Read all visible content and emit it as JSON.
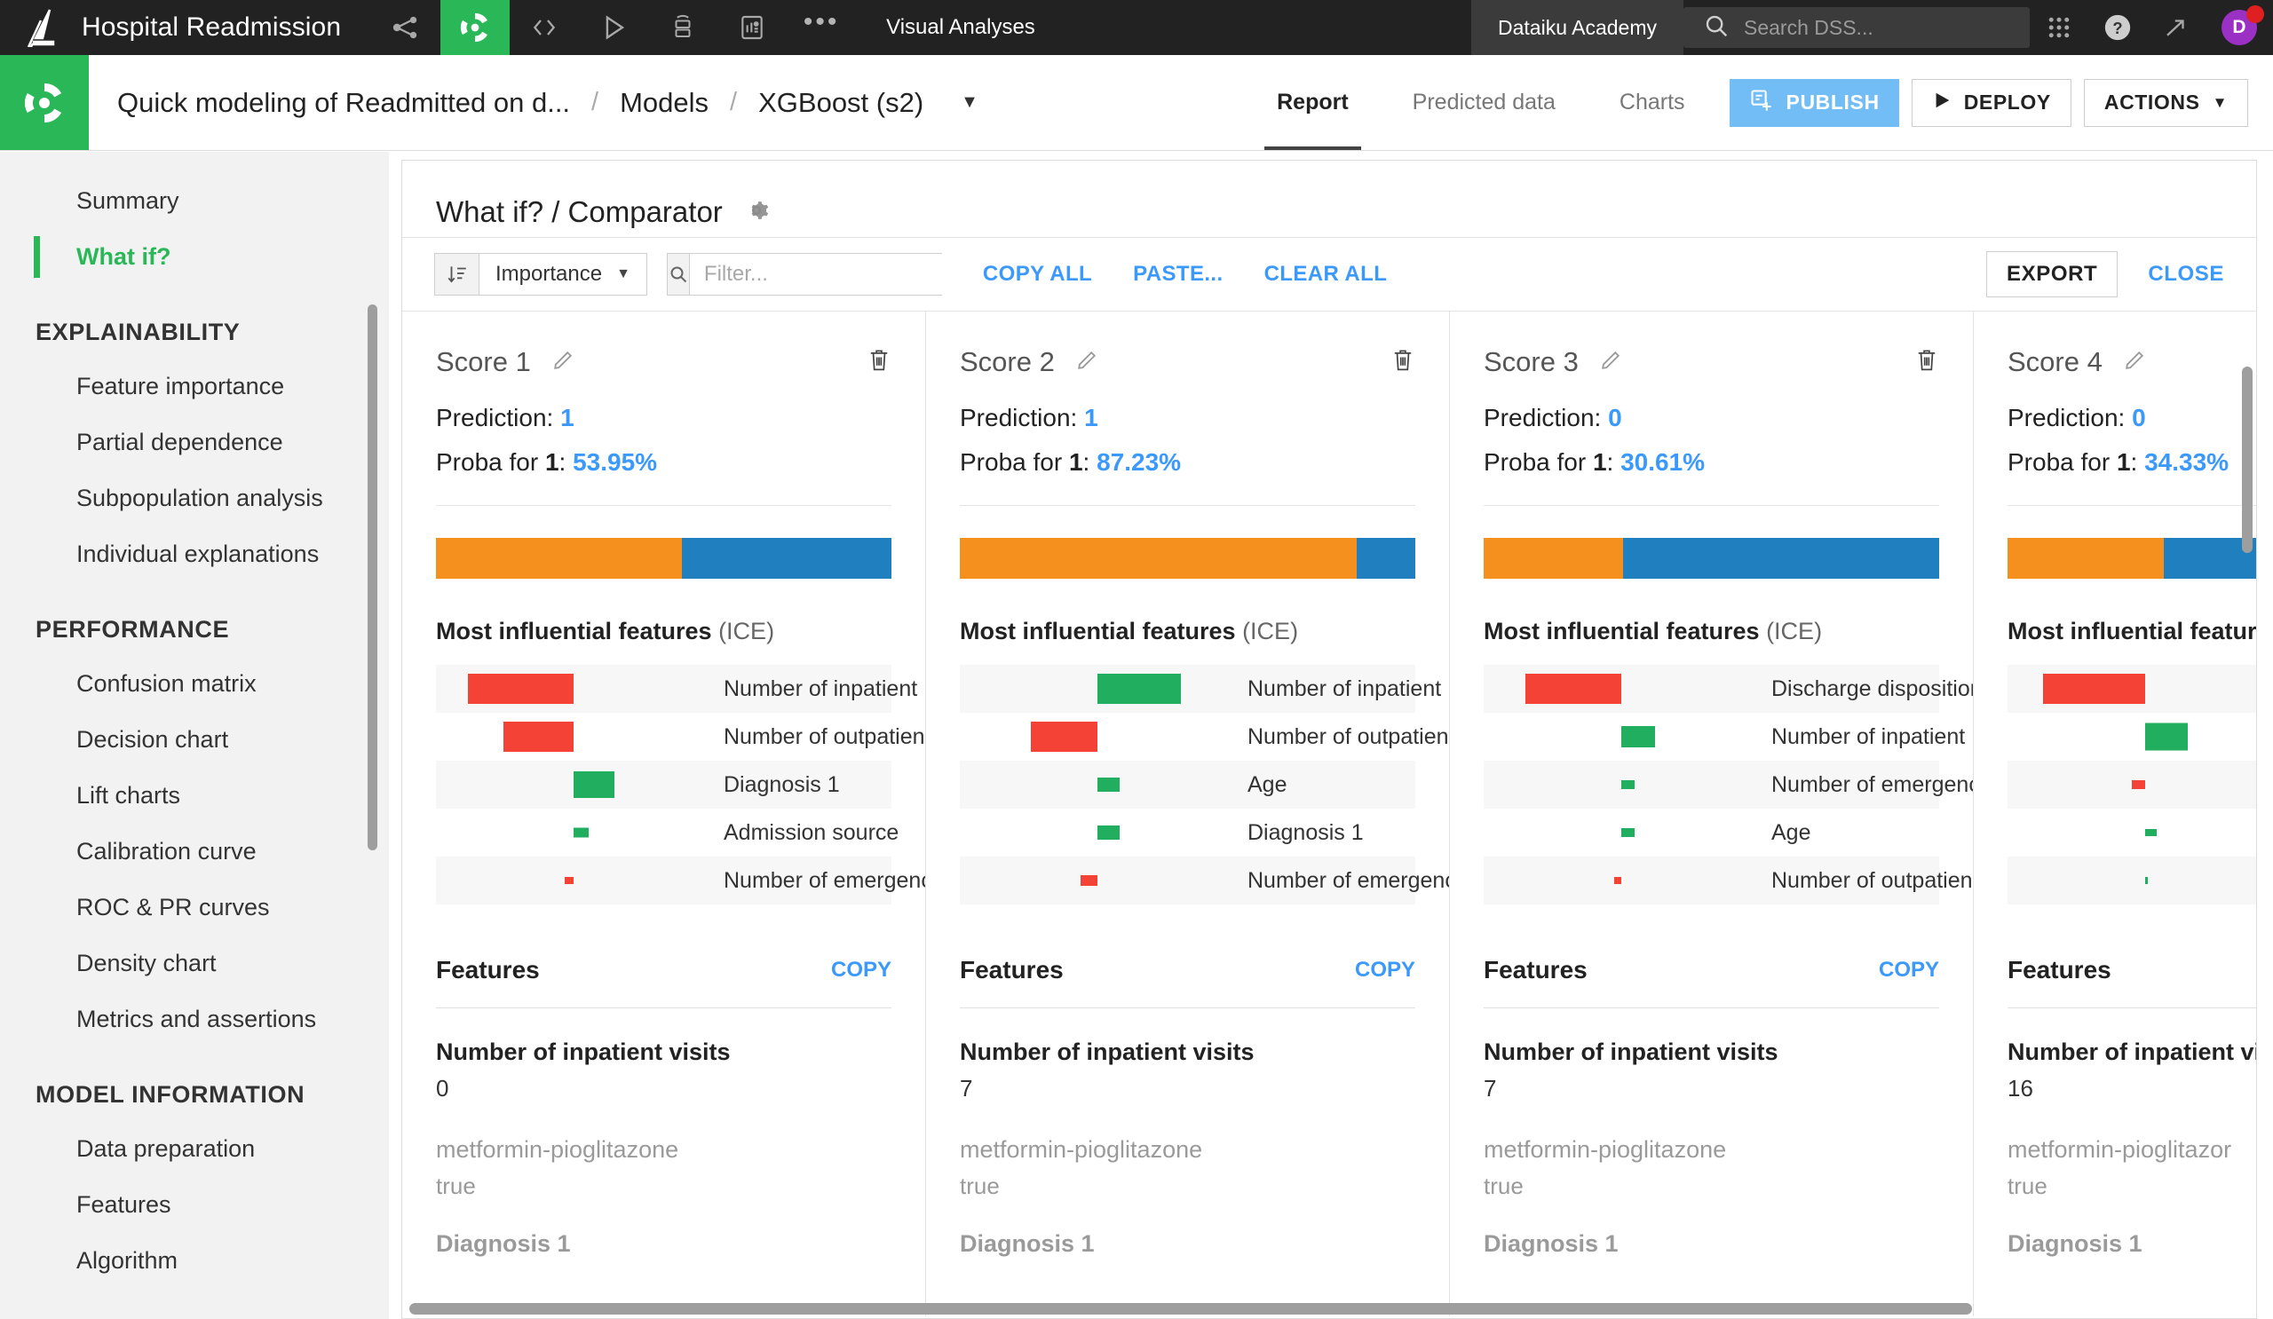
{
  "topbar": {
    "project_name": "Hospital Readmission",
    "icons": [
      "flow-icon",
      "dataiku-logo-icon",
      "code-icon",
      "play-icon",
      "jobs-icon",
      "dashboard-icon",
      "more-icon"
    ],
    "section_label": "Visual Analyses",
    "academy_label": "Dataiku Academy",
    "search_placeholder": "Search DSS...",
    "right_icons": [
      "apps-grid-icon",
      "help-icon",
      "trends-icon"
    ],
    "avatar_initial": "D"
  },
  "header": {
    "breadcrumb": [
      {
        "label": "Quick modeling of Readmitted on d..."
      },
      {
        "label": "Models"
      },
      {
        "label": "XGBoost (s2)"
      }
    ],
    "separator": "/",
    "tabs": [
      {
        "label": "Report",
        "active": true
      },
      {
        "label": "Predicted data",
        "active": false
      },
      {
        "label": "Charts",
        "active": false
      }
    ],
    "publish_label": "PUBLISH",
    "deploy_label": "DEPLOY",
    "actions_label": "ACTIONS"
  },
  "sidebar": {
    "top_items": [
      {
        "label": "Summary",
        "active": false
      },
      {
        "label": "What if?",
        "active": true
      }
    ],
    "sections": [
      {
        "heading": "EXPLAINABILITY",
        "items": [
          {
            "label": "Feature importance"
          },
          {
            "label": "Partial dependence"
          },
          {
            "label": "Subpopulation analysis"
          },
          {
            "label": "Individual explanations"
          }
        ]
      },
      {
        "heading": "PERFORMANCE",
        "items": [
          {
            "label": "Confusion matrix"
          },
          {
            "label": "Decision chart"
          },
          {
            "label": "Lift charts"
          },
          {
            "label": "Calibration curve"
          },
          {
            "label": "ROC & PR curves"
          },
          {
            "label": "Density chart"
          },
          {
            "label": "Metrics and assertions"
          }
        ]
      },
      {
        "heading": "MODEL INFORMATION",
        "items": [
          {
            "label": "Data preparation"
          },
          {
            "label": "Features"
          },
          {
            "label": "Algorithm"
          }
        ]
      }
    ]
  },
  "panel": {
    "title": "What if? / Comparator",
    "gear_icon": "gear-icon",
    "toolbar": {
      "sort_icon": "sort-descending-icon",
      "sort_value": "Importance",
      "search_icon": "search-icon",
      "filter_placeholder": "Filter...",
      "filter_value": "",
      "copy_all_label": "COPY ALL",
      "paste_label": "PASTE...",
      "clear_all_label": "CLEAR ALL",
      "export_label": "EXPORT",
      "close_label": "CLOSE"
    }
  },
  "cards": [
    {
      "title": "Score 1",
      "prediction_label": "Prediction:",
      "prediction_value": "1",
      "proba_label_pre": "Proba for ",
      "proba_label_class": "1",
      "proba_label_post": ":",
      "proba_value": "53.95%",
      "proba_pct": 53.95,
      "mif_title": "Most influential features",
      "mif_sub": "(ICE)",
      "features_label": "Features",
      "copy_label": "COPY",
      "feature_rows": [
        {
          "name": "Number of inpatient visits",
          "value": "0",
          "dim": false
        },
        {
          "name": "metformin-pioglitazone",
          "value": "true",
          "dim": true
        }
      ],
      "ice": [
        {
          "label": "Number of inpatient",
          "value": -0.57,
          "sign": "neg"
        },
        {
          "label": "Number of outpatien",
          "value": -0.38,
          "sign": "neg"
        },
        {
          "label": "Diagnosis 1",
          "value": 0.22,
          "sign": "pos"
        },
        {
          "label": "Admission source",
          "value": 0.08,
          "sign": "pos"
        },
        {
          "label": "Number of emergenc",
          "value": -0.05,
          "sign": "neg"
        }
      ]
    },
    {
      "title": "Score 2",
      "prediction_label": "Prediction:",
      "prediction_value": "1",
      "proba_label_pre": "Proba for ",
      "proba_label_class": "1",
      "proba_label_post": ":",
      "proba_value": "87.23%",
      "proba_pct": 87.23,
      "mif_title": "Most influential features",
      "mif_sub": "(ICE)",
      "features_label": "Features",
      "copy_label": "COPY",
      "feature_rows": [
        {
          "name": "Number of inpatient visits",
          "value": "7",
          "dim": false
        },
        {
          "name": "metformin-pioglitazone",
          "value": "true",
          "dim": true
        }
      ],
      "ice": [
        {
          "label": "Number of inpatient",
          "value": 0.45,
          "sign": "pos"
        },
        {
          "label": "Number of outpatien",
          "value": -0.36,
          "sign": "neg"
        },
        {
          "label": "Age",
          "value": 0.12,
          "sign": "pos"
        },
        {
          "label": "Diagnosis 1",
          "value": 0.12,
          "sign": "pos"
        },
        {
          "label": "Number of emergenc",
          "value": -0.09,
          "sign": "neg"
        }
      ]
    },
    {
      "title": "Score 3",
      "prediction_label": "Prediction:",
      "prediction_value": "0",
      "proba_label_pre": "Proba for ",
      "proba_label_class": "1",
      "proba_label_post": ":",
      "proba_value": "30.61%",
      "proba_pct": 30.61,
      "mif_title": "Most influential features",
      "mif_sub": "(ICE)",
      "features_label": "Features",
      "copy_label": "COPY",
      "feature_rows": [
        {
          "name": "Number of inpatient visits",
          "value": "7",
          "dim": false
        },
        {
          "name": "metformin-pioglitazone",
          "value": "true",
          "dim": true
        }
      ],
      "ice": [
        {
          "label": "Discharge disposition",
          "value": -0.52,
          "sign": "neg"
        },
        {
          "label": "Number of inpatient",
          "value": 0.18,
          "sign": "pos"
        },
        {
          "label": "Number of emergenc",
          "value": 0.07,
          "sign": "pos"
        },
        {
          "label": "Age",
          "value": 0.07,
          "sign": "pos"
        },
        {
          "label": "Number of outpatien",
          "value": -0.04,
          "sign": "neg"
        }
      ]
    },
    {
      "title": "Score 4",
      "prediction_label": "Prediction:",
      "prediction_value": "0",
      "proba_label_pre": "Proba for ",
      "proba_label_class": "1",
      "proba_label_post": ":",
      "proba_value": "34.33%",
      "proba_pct": 34.33,
      "mif_title": "Most influential featur",
      "mif_sub": "",
      "features_label": "Features",
      "copy_label": "",
      "feature_rows": [
        {
          "name": "Number of inpatient vi",
          "value": "16",
          "dim": false
        },
        {
          "name": "metformin-pioglitazor",
          "value": "true",
          "dim": true
        }
      ],
      "ice": [
        {
          "label": "",
          "value": -0.55,
          "sign": "neg"
        },
        {
          "label": "",
          "value": 0.23,
          "sign": "pos"
        },
        {
          "label": "",
          "value": -0.07,
          "sign": "neg"
        },
        {
          "label": "",
          "value": 0.06,
          "sign": "pos"
        },
        {
          "label": "",
          "value": 0.01,
          "sign": "pos"
        }
      ]
    }
  ]
}
